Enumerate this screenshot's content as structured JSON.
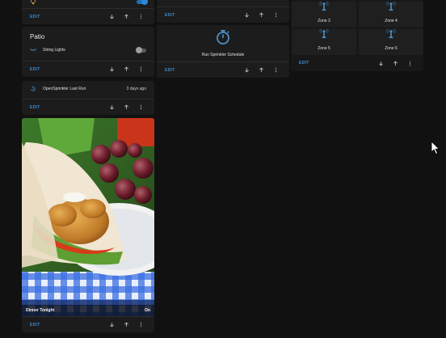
{
  "common": {
    "edit_label": "EDIT"
  },
  "colors": {
    "accent": "#3d8dd6",
    "card_bg": "#1c1c1c",
    "page_bg": "#111111",
    "icon_blue": "#4a90c9"
  },
  "col1": {
    "top_card": {
      "row_label": "",
      "toggle_state": "on"
    },
    "patio_card": {
      "title": "Patio",
      "row_label": "String Lights",
      "toggle_state": "off"
    },
    "last_run_card": {
      "label": "OpenSprinkler Last Run",
      "value": "3 days ago"
    },
    "picture_card": {
      "caption_left": "Dinner Tonight",
      "caption_right": "On"
    }
  },
  "col2": {
    "script_card": {
      "name": "Run Sprinkler Schedule",
      "icon": "timer-icon"
    }
  },
  "col3": {
    "zones": [
      {
        "name": "Zone 3",
        "icon": "sprinkler-icon"
      },
      {
        "name": "Zone 4",
        "icon": "sprinkler-icon"
      },
      {
        "name": "Zone 5",
        "icon": "sprinkler-icon"
      },
      {
        "name": "Zone 6",
        "icon": "sprinkler-icon"
      }
    ]
  }
}
